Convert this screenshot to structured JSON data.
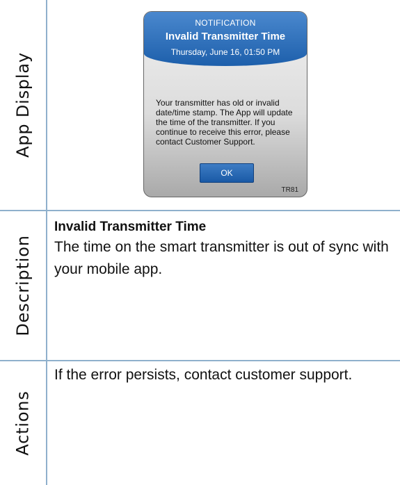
{
  "sections": {
    "app_display_label": "App Display",
    "description_label": "Description",
    "actions_label": "Actions"
  },
  "notification": {
    "kicker": "NOTIFICATION",
    "title": "Invalid Transmitter Time",
    "date": "Thursday, June 16, 01:50 PM",
    "body": "Your transmitter has old or invalid date/time stamp. The App will update the time of the transmitter. If you continue to receive this error, please contact Customer Support.",
    "ok_label": "OK",
    "code": "TR81"
  },
  "description": {
    "title": "Invalid Transmitter Time",
    "text": "The time on the smart transmitter is out of sync with your mobile app."
  },
  "actions": {
    "text": "If the error persists, contact customer support."
  },
  "colors": {
    "header_blue": "#2f6fba",
    "divider": "#8fb0cc"
  }
}
